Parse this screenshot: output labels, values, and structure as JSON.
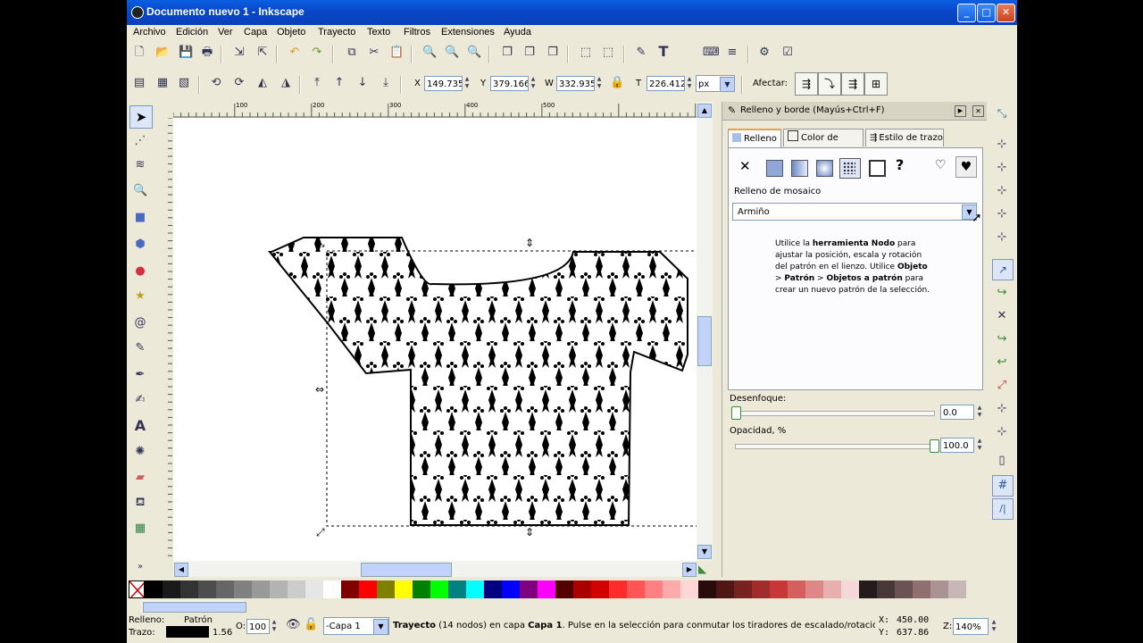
{
  "window": {
    "title": "Documento nuevo 1 - Inkscape",
    "minimize": "_",
    "maximize": "□",
    "close": "✕"
  },
  "menu": [
    "Archivo",
    "Edición",
    "Ver",
    "Capa",
    "Objeto",
    "Trayecto",
    "Texto",
    "Filtros",
    "Extensiones",
    "Ayuda"
  ],
  "toolbar_controls": {
    "x_label": "X",
    "x_value": "149.735",
    "y_label": "Y",
    "y_value": "379.166",
    "w_label": "W",
    "w_value": "332.935",
    "h_label": "T",
    "h_value": "226.412",
    "unit": "px",
    "affect_label": "Afectar:"
  },
  "ruler_marks": [
    "100",
    "200",
    "300",
    "400",
    "500"
  ],
  "panel": {
    "title": "Relleno y borde (Mayús+Ctrl+F)",
    "tabs": [
      "Relleno",
      "Color de trazo",
      "Estilo de trazo"
    ],
    "paint_buttons": {
      "none": "✕",
      "unset": "?"
    },
    "pattern_section": "Relleno de mosaico",
    "pattern_value": "Armiño",
    "help_text": {
      "p1": "Utilice la ",
      "b1": "herramienta Nodo",
      "p2": " para ajustar la posición, escala y rotación del patrón en el lienzo. Utilice ",
      "b2": "Objeto",
      "p3": " > ",
      "b3": "Patrón",
      "p4": " > ",
      "b4": "Objetos a patrón",
      "p5": " para crear un nuevo patrón de la selección."
    },
    "blur_label": "Desenfoque:",
    "blur_value": "0.0",
    "blur_level": 0,
    "opacity_label": "Opacidad, %",
    "opacity_value": "100.0",
    "opacity_level": 100
  },
  "palette": [
    "#000000",
    "#1a1a1a",
    "#333333",
    "#4d4d4d",
    "#666666",
    "#808080",
    "#999999",
    "#b3b3b3",
    "#cccccc",
    "#e6e6e6",
    "#ffffff",
    "#800000",
    "#ff0000",
    "#808000",
    "#ffff00",
    "#008000",
    "#00ff00",
    "#008080",
    "#00ffff",
    "#000080",
    "#0000ff",
    "#800080",
    "#ff00ff",
    "#550000",
    "#aa0000",
    "#d40000",
    "#ff2a2a",
    "#ff5555",
    "#ff8080",
    "#ffaaaa",
    "#ffd5d5",
    "#280b0b",
    "#501616",
    "#782121",
    "#a02c2c",
    "#c83737",
    "#d35f5f",
    "#de8787",
    "#e9afaf",
    "#f4d7d7",
    "#241c1c",
    "#483737",
    "#6c5353",
    "#916f6f",
    "#ac9393",
    "#c8b7b7"
  ],
  "status": {
    "fill_label": "Relleno:",
    "fill_value": "Patrón",
    "stroke_label": "Trazo:",
    "stroke_width": "1.56",
    "opacity_label": "O:",
    "opacity_value": "100",
    "layer": "-Capa 1",
    "message_b1": "Trayecto",
    "message_p1": " (14 nodos) en capa ",
    "message_b2": "Capa 1",
    "message_p2": ". Pulse en la selección para conmutar los tiradores de escalado/rotación.",
    "x_label": "X:",
    "x_value": "450.00",
    "y_label": "Y:",
    "y_value": "637.86",
    "zoom_label": "Z:",
    "zoom_value": "140%"
  },
  "colors": {
    "titlebar": "#0a4fd0",
    "chrome": "#ece9d8",
    "accent": "#316ac5"
  }
}
